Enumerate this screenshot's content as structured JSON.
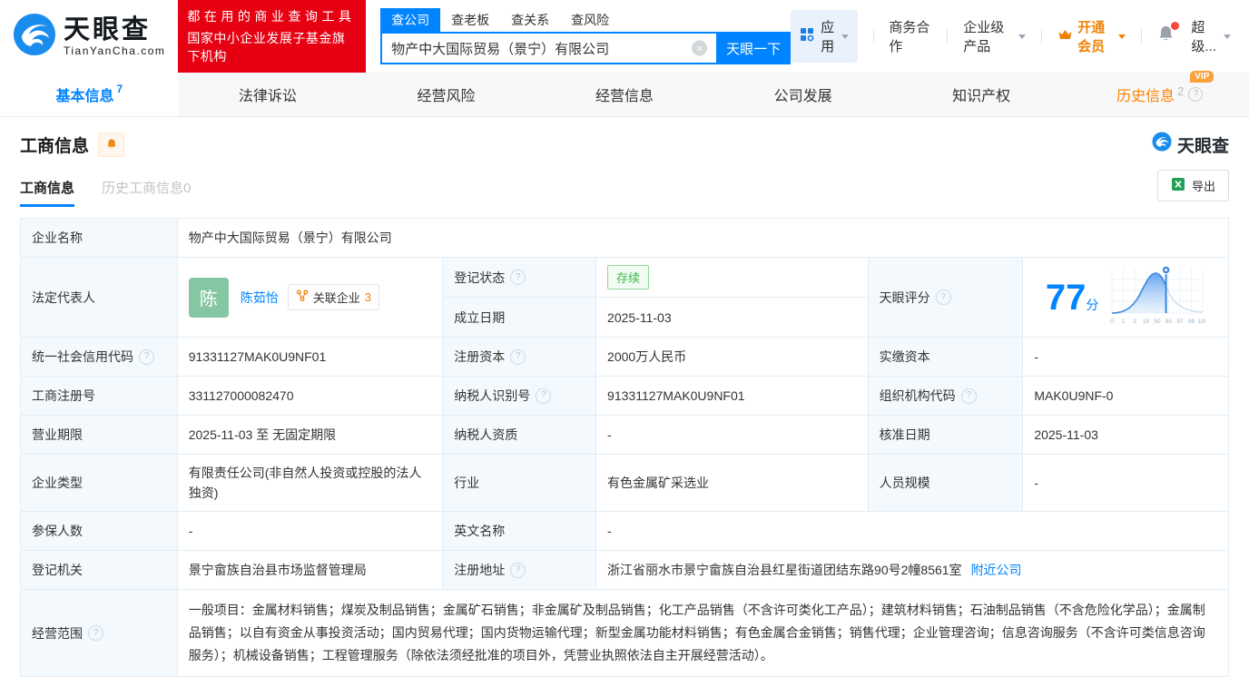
{
  "brand": {
    "name": "天眼查",
    "domain": "TianYanCha.com",
    "slogan_line1": "都在用的商业查询工具",
    "slogan_line2": "国家中小企业发展子基金旗下机构"
  },
  "search": {
    "tabs": [
      "查公司",
      "查老板",
      "查关系",
      "查风险"
    ],
    "active_tab": "查公司",
    "value": "物产中大国际贸易（景宁）有限公司",
    "button": "天眼一下"
  },
  "topmenu": {
    "apps": "应用",
    "cooperation": "商务合作",
    "enterprise": "企业级产品",
    "membership": "开通会员",
    "user": "超级..."
  },
  "nav": {
    "tabs": [
      {
        "label": "基本信息",
        "count": "7"
      },
      {
        "label": "法律诉讼"
      },
      {
        "label": "经营风险"
      },
      {
        "label": "经营信息"
      },
      {
        "label": "公司发展"
      },
      {
        "label": "知识产权"
      },
      {
        "label": "历史信息",
        "count": "2",
        "badge": "VIP"
      }
    ]
  },
  "section": {
    "title": "工商信息",
    "subtab_active": "工商信息",
    "subtab_history": "历史工商信息",
    "subtab_history_count": "0",
    "export": "导出",
    "watermark": "天眼查"
  },
  "fields": {
    "company_name": {
      "label": "企业名称",
      "value": "物产中大国际贸易（景宁）有限公司"
    },
    "legal_rep": {
      "label": "法定代表人",
      "avatar": "陈",
      "name": "陈茹怡",
      "related_label": "关联企业",
      "related_count": "3"
    },
    "reg_status": {
      "label": "登记状态",
      "value": "存续"
    },
    "establish_date": {
      "label": "成立日期",
      "value": "2025-11-03"
    },
    "score": {
      "label": "天眼评分",
      "value": "77",
      "unit": "分"
    },
    "unified_code": {
      "label": "统一社会信用代码",
      "value": "91331127MAK0U9NF01"
    },
    "reg_capital": {
      "label": "注册资本",
      "value": "2000万人民币"
    },
    "paid_capital": {
      "label": "实缴资本",
      "value": "-"
    },
    "reg_number": {
      "label": "工商注册号",
      "value": "331127000082470"
    },
    "taxpayer_id": {
      "label": "纳税人识别号",
      "value": "91331127MAK0U9NF01"
    },
    "org_code": {
      "label": "组织机构代码",
      "value": "MAK0U9NF-0"
    },
    "business_term": {
      "label": "营业期限",
      "value": "2025-11-03 至 无固定期限"
    },
    "taxpayer_qual": {
      "label": "纳税人资质",
      "value": "-"
    },
    "approval_date": {
      "label": "核准日期",
      "value": "2025-11-03"
    },
    "company_type": {
      "label": "企业类型",
      "value": "有限责任公司(非自然人投资或控股的法人独资)"
    },
    "industry": {
      "label": "行业",
      "value": "有色金属矿采选业"
    },
    "staff_size": {
      "label": "人员规模",
      "value": "-"
    },
    "insured_count": {
      "label": "参保人数",
      "value": "-"
    },
    "english_name": {
      "label": "英文名称",
      "value": "-"
    },
    "reg_authority": {
      "label": "登记机关",
      "value": "景宁畲族自治县市场监督管理局"
    },
    "reg_address": {
      "label": "注册地址",
      "value": "浙江省丽水市景宁畲族自治县红星街道团结东路90号2幢8561室",
      "nearby_link": "附近公司"
    },
    "business_scope": {
      "label": "经营范围",
      "value": "一般项目：金属材料销售；煤炭及制品销售；金属矿石销售；非金属矿及制品销售；化工产品销售（不含许可类化工产品）；建筑材料销售；石油制品销售（不含危险化学品）；金属制品销售；以自有资金从事投资活动；国内贸易代理；国内货物运输代理；新型金属功能材料销售；有色金属合金销售；销售代理；企业管理咨询；信息咨询服务（不含许可类信息咨询服务）；机械设备销售；工程管理服务（除依法须经批准的项目外，凭营业执照依法自主开展经营活动）。"
    }
  },
  "score_chart": {
    "type": "area",
    "title": "天眼评分",
    "score": 77,
    "unit": "分",
    "x_ticks": [
      "0",
      "1",
      "3",
      "15",
      "50",
      "85",
      "97",
      "99",
      "100"
    ],
    "marker_value": 77,
    "description": "percentile bell-curve, blue filled up to marker at score 77",
    "colors": {
      "curve": "#3a87e0",
      "fill_top": "#5b9ff0",
      "inactive_curve": "#c9dcf0"
    }
  },
  "icons": {
    "question_mark": "?",
    "clear": "×"
  },
  "colors": {
    "primary": "#0084ff",
    "banner_red": "#e60012",
    "vip_orange": "#ff8000",
    "status_green": "#3db54a",
    "avatar_green": "#85c7a3",
    "label_bg": "#f3f9fd",
    "border": "#e3edf6"
  }
}
